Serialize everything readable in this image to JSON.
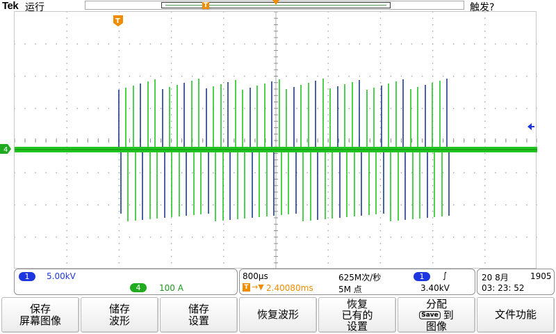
{
  "top_bar": {
    "brand": "Tek",
    "run_status": "运行",
    "trigger_status": "触发?",
    "record_trigger_marker": "T"
  },
  "colors": {
    "ch1": "#1e36e0",
    "ch4": "#1faa1f",
    "trigger": "#f08c00",
    "ch1_trace": "#1a3a8c",
    "ch4_trace": "#22c422"
  },
  "markers": {
    "ch4_ground": "4",
    "trigger_position": "T"
  },
  "channels_panel": {
    "ch1": {
      "number": "1",
      "scale": "5.00kV"
    },
    "ch4": {
      "number": "4",
      "scale": "100 A"
    }
  },
  "timebase_panel": {
    "horizontal_scale": "800µs",
    "sample_rate": "625M次/秒",
    "trigger_source": "1",
    "trigger_slope": "∫",
    "trigger_position_icon": "T",
    "trigger_delay": "2.40080ms",
    "record_length": "5M 点",
    "trigger_level": "3.40kV"
  },
  "clock_panel": {
    "date": "20 8月",
    "year": "1905",
    "time": "03: 23: 52"
  },
  "softkeys": [
    {
      "line1": "保存",
      "line2": "屏幕图像"
    },
    {
      "line1": "储存",
      "line2": "波形"
    },
    {
      "line1": "储存",
      "line2": "设置"
    },
    {
      "line1": "恢复波形",
      "line2": ""
    },
    {
      "line1": "恢复",
      "line2": "已有的",
      "line3": "设置"
    },
    {
      "line1": "分配",
      "line2_icon": "Save",
      "line2": "到",
      "line3": "图像"
    },
    {
      "line1": "文件功能",
      "line2": ""
    }
  ]
}
